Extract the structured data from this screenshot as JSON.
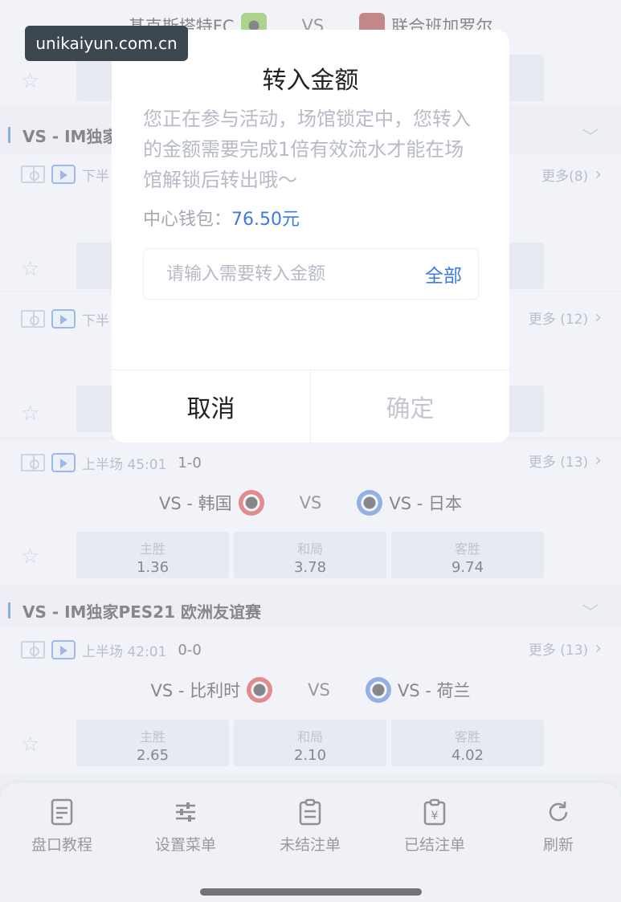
{
  "watermark": "unikaiyun.com.cn",
  "top_match": {
    "home": "基克斯塔特FC",
    "vs": "VS",
    "away": "联合班加罗尔"
  },
  "leagues": [
    {
      "title": "VS - IM独家"
    },
    {
      "title": "VS - IM独家PES21 欧洲友谊赛"
    }
  ],
  "match_rows": [
    {
      "period": "下半",
      "more": "更多(8)"
    },
    {
      "period": "下半",
      "more": "更多 (12)"
    }
  ],
  "match_korea": {
    "period": "上半场 45:01",
    "score": "1-0",
    "more": "更多 (13)",
    "home": "VS - 韩国",
    "vs": "VS",
    "away": "VS - 日本",
    "odds": [
      {
        "label": "主胜",
        "value": "1.36"
      },
      {
        "label": "和局",
        "value": "3.78"
      },
      {
        "label": "客胜",
        "value": "9.74"
      }
    ]
  },
  "match_belgium": {
    "period": "上半场 42:01",
    "score": "0-0",
    "more": "更多 (13)",
    "home": "VS - 比利时",
    "vs": "VS",
    "away": "VS - 荷兰",
    "odds": [
      {
        "label": "主胜",
        "value": "2.65"
      },
      {
        "label": "和局",
        "value": "2.10"
      },
      {
        "label": "客胜",
        "value": "4.02"
      }
    ]
  },
  "modal": {
    "title": "转入金额",
    "message": "您正在参与活动，场馆锁定中，您转入的金额需要完成1倍有效流水才能在场馆解锁后转出哦～",
    "wallet_label": "中心钱包：",
    "wallet_amount": "76.50元",
    "input_placeholder": "请输入需要转入金额",
    "all_label": "全部",
    "cancel_label": "取消",
    "confirm_label": "确定"
  },
  "bottom_nav": [
    {
      "label": "盘口教程",
      "icon": "document-icon"
    },
    {
      "label": "设置菜单",
      "icon": "sliders-icon"
    },
    {
      "label": "未结注单",
      "icon": "clipboard-icon"
    },
    {
      "label": "已结注单",
      "icon": "receipt-icon"
    },
    {
      "label": "刷新",
      "icon": "refresh-icon"
    }
  ],
  "colors": {
    "accent": "#3d7be0",
    "muted_text": "#b7bbc6",
    "background": "#eef0f6"
  }
}
